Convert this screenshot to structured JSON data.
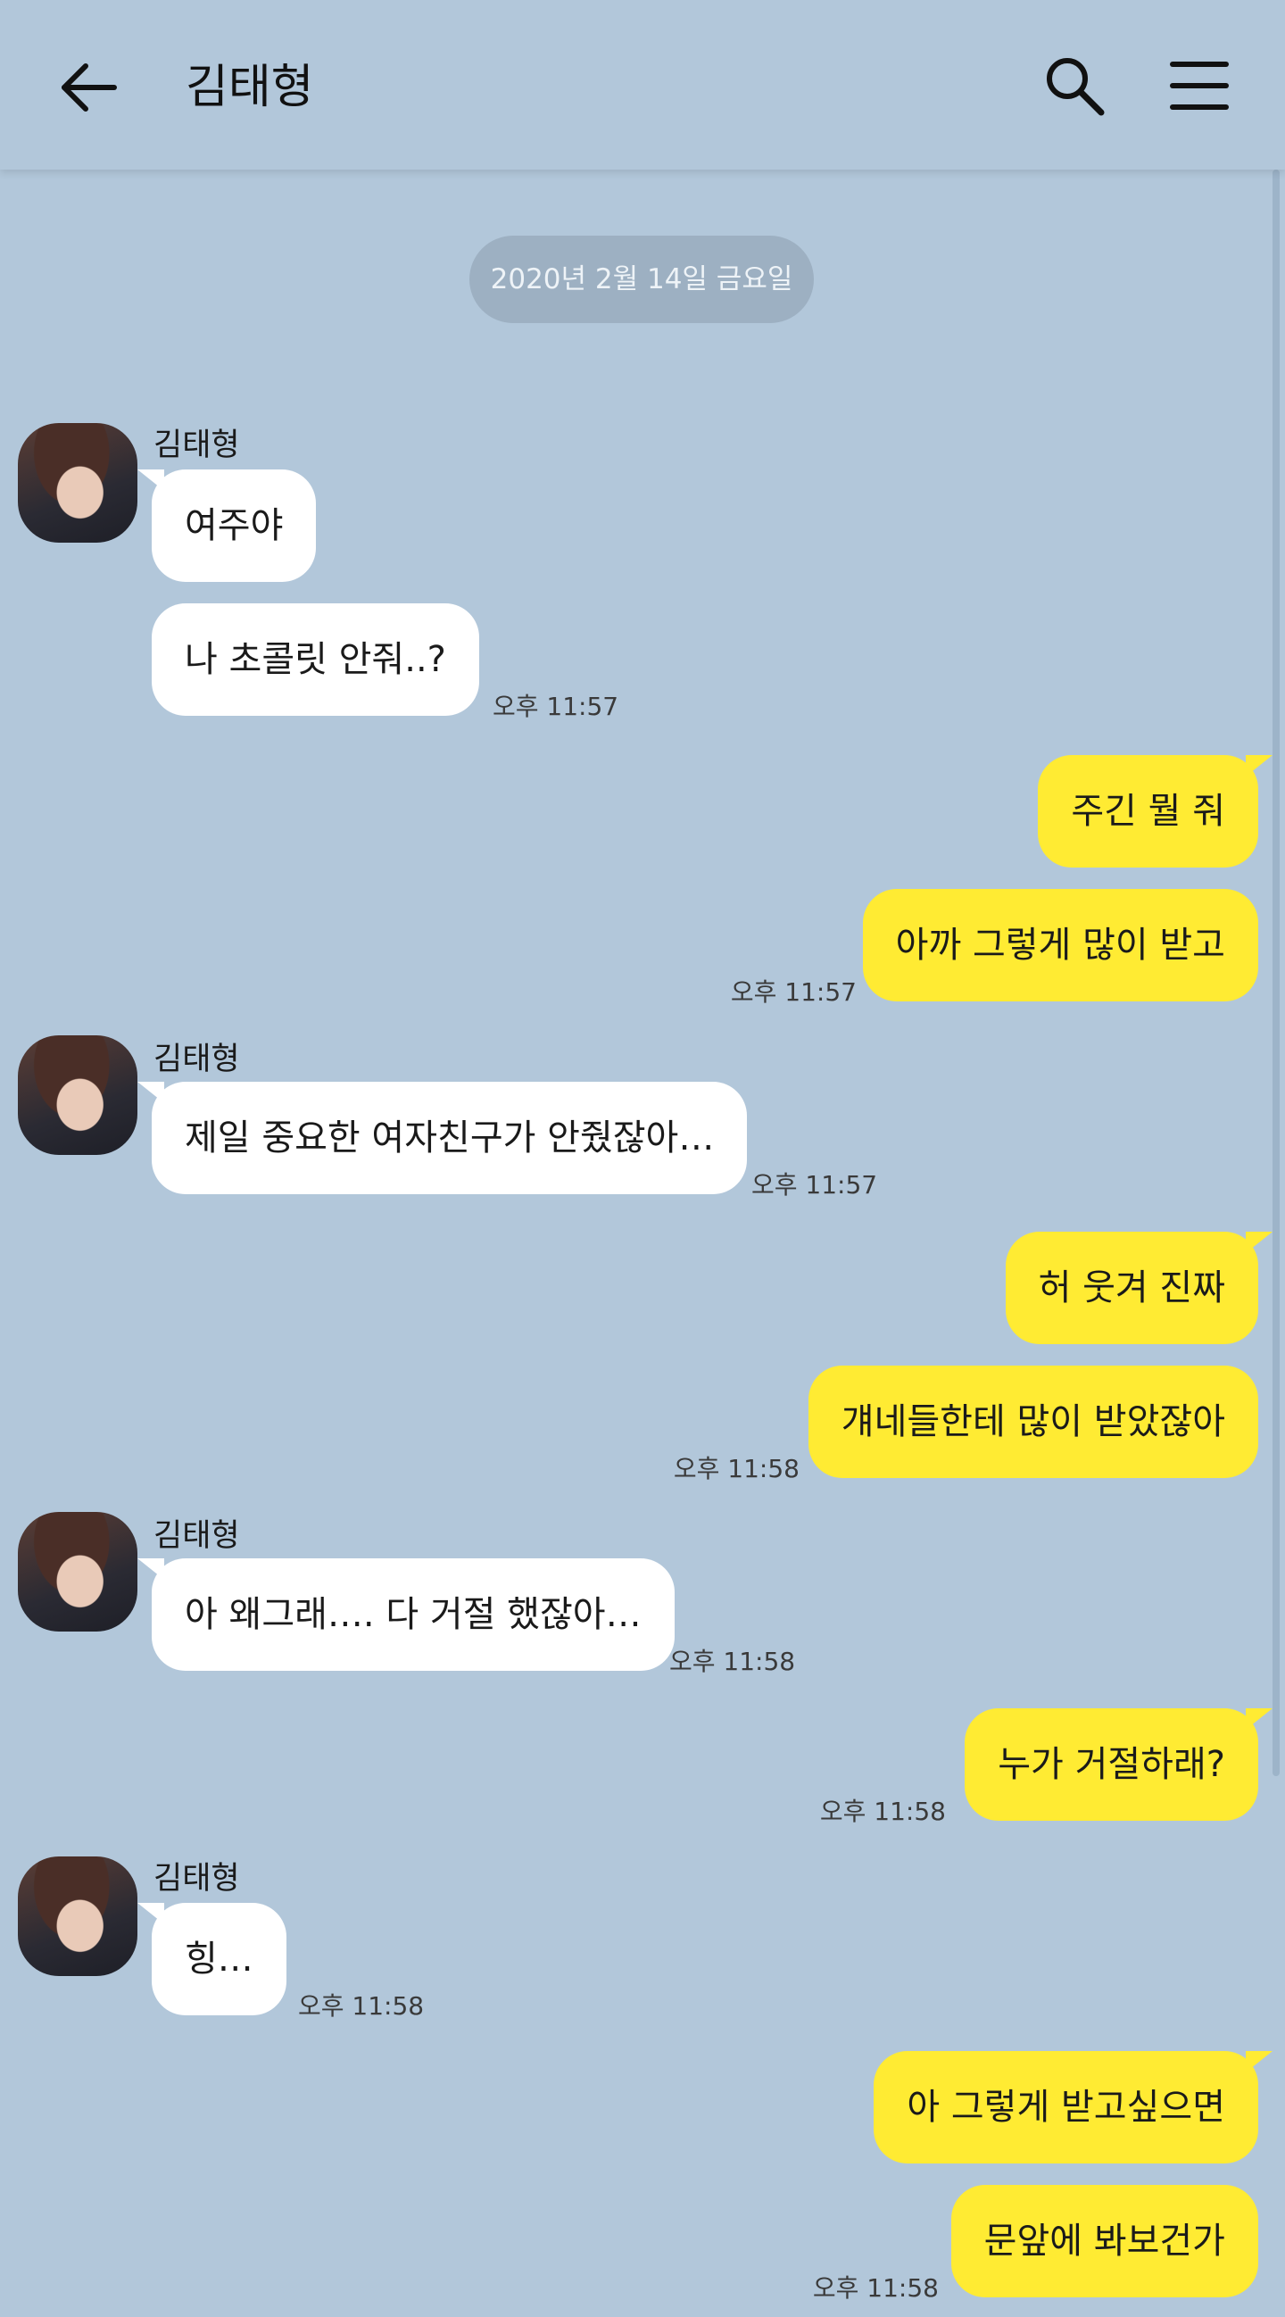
{
  "header": {
    "title": "김태형",
    "back_icon": "arrow-left-icon",
    "search_icon": "search-icon",
    "menu_icon": "hamburger-menu-icon"
  },
  "date_divider": "2020년 2월 14일 금요일",
  "colors": {
    "background": "#b2c7da",
    "incoming_bubble": "#ffffff",
    "outgoing_bubble": "#ffeb33",
    "date_pill": "#9db0c2"
  },
  "messages": [
    {
      "sender": "김태형",
      "text": "여주야"
    },
    {
      "text": "나 초콜릿 안줘..?",
      "time": "오후 11:57"
    },
    {
      "text": "주긴 뭘 줘"
    },
    {
      "text": "아까 그렇게 많이 받고",
      "time": "오후 11:57"
    },
    {
      "sender": "김태형",
      "text": "제일 중요한 여자친구가 안줬잖아…",
      "time": "오후 11:57"
    },
    {
      "text": "허 웃겨 진짜"
    },
    {
      "text": "걔네들한테 많이 받았잖아",
      "time": "오후 11:58"
    },
    {
      "sender": "김태형",
      "text": "아 왜그래…. 다 거절 했잖아…",
      "time": "오후 11:58"
    },
    {
      "text": "누가 거절하래?",
      "time": "오후 11:58"
    },
    {
      "sender": "김태형",
      "text": "힝…",
      "time": "오후 11:58"
    },
    {
      "text": "아 그렇게 받고싶으면"
    },
    {
      "text": "문앞에 봐보건가",
      "time": "오후 11:58"
    }
  ]
}
